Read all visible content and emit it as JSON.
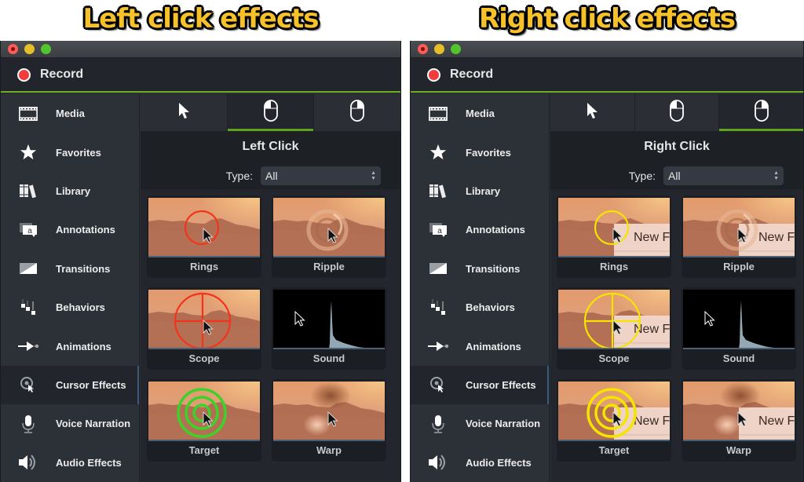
{
  "panels": [
    {
      "caption": "Left click effects",
      "toolbar": {
        "record_label": "Record"
      },
      "sidebar": {
        "items": [
          {
            "label": "Media",
            "icon": "film-icon"
          },
          {
            "label": "Favorites",
            "icon": "star-icon"
          },
          {
            "label": "Library",
            "icon": "books-icon"
          },
          {
            "label": "Annotations",
            "icon": "callout-icon"
          },
          {
            "label": "Transitions",
            "icon": "transition-icon"
          },
          {
            "label": "Behaviors",
            "icon": "behaviors-icon"
          },
          {
            "label": "Animations",
            "icon": "arrow-dot-icon"
          },
          {
            "label": "Cursor Effects",
            "icon": "cursor-target-icon",
            "active": true
          },
          {
            "label": "Voice Narration",
            "icon": "microphone-icon"
          },
          {
            "label": "Audio Effects",
            "icon": "speaker-icon"
          }
        ]
      },
      "tabs": [
        {
          "name": "cursor",
          "icon": "pointer-icon"
        },
        {
          "name": "left-click",
          "icon": "mouse-left-icon",
          "active": true
        },
        {
          "name": "right-click",
          "icon": "mouse-right-icon"
        }
      ],
      "section_title": "Left Click",
      "type_filter": {
        "label": "Type:",
        "value": "All"
      },
      "effect_color": "#f2341c",
      "target_color": "#3ed12a",
      "cards": [
        {
          "label": "Rings"
        },
        {
          "label": "Ripple"
        },
        {
          "label": "Scope"
        },
        {
          "label": "Sound"
        },
        {
          "label": "Target"
        },
        {
          "label": "Warp"
        }
      ]
    },
    {
      "caption": "Right click effects",
      "toolbar": {
        "record_label": "Record"
      },
      "sidebar": {
        "items": [
          {
            "label": "Media",
            "icon": "film-icon"
          },
          {
            "label": "Favorites",
            "icon": "star-icon"
          },
          {
            "label": "Library",
            "icon": "books-icon"
          },
          {
            "label": "Annotations",
            "icon": "callout-icon"
          },
          {
            "label": "Transitions",
            "icon": "transition-icon"
          },
          {
            "label": "Behaviors",
            "icon": "behaviors-icon"
          },
          {
            "label": "Animations",
            "icon": "arrow-dot-icon"
          },
          {
            "label": "Cursor Effects",
            "icon": "cursor-target-icon",
            "active": true
          },
          {
            "label": "Voice Narration",
            "icon": "microphone-icon"
          },
          {
            "label": "Audio Effects",
            "icon": "speaker-icon"
          }
        ]
      },
      "tabs": [
        {
          "name": "cursor",
          "icon": "pointer-icon"
        },
        {
          "name": "left-click",
          "icon": "mouse-left-icon"
        },
        {
          "name": "right-click",
          "icon": "mouse-right-icon",
          "active": true
        }
      ],
      "section_title": "Right Click",
      "type_filter": {
        "label": "Type:",
        "value": "All"
      },
      "effect_color": "#f5e400",
      "target_color": "#f5e400",
      "context_menu_text": "New F",
      "cards": [
        {
          "label": "Rings"
        },
        {
          "label": "Ripple"
        },
        {
          "label": "Scope"
        },
        {
          "label": "Sound"
        },
        {
          "label": "Target"
        },
        {
          "label": "Warp"
        }
      ]
    }
  ]
}
